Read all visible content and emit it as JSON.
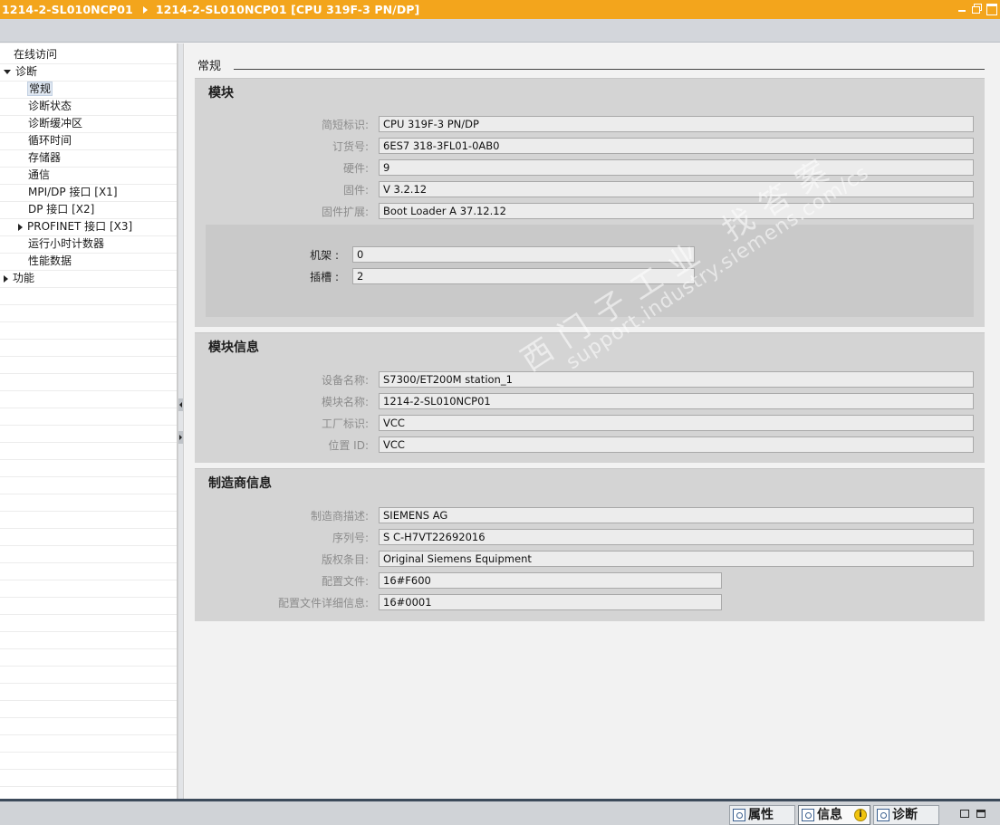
{
  "titlebar": {
    "crumb1": "1214-2-SL010NCP01",
    "crumb2": "1214-2-SL010NCP01 [CPU 319F-3 PN/DP]",
    "minimize_icon": "minimize-icon",
    "restore_icon": "restore-icon",
    "maximize_icon": "maximize-icon"
  },
  "tree": {
    "items": [
      {
        "label": "在线访问"
      },
      {
        "label": "诊断",
        "expanded": true
      },
      {
        "label": "常规",
        "selected": true
      },
      {
        "label": "诊断状态"
      },
      {
        "label": "诊断缓冲区"
      },
      {
        "label": "循环时间"
      },
      {
        "label": "存储器"
      },
      {
        "label": "通信"
      },
      {
        "label": "MPI/DP 接口 [X1]"
      },
      {
        "label": "DP 接口 [X2]"
      },
      {
        "label": "PROFINET 接口 [X3]",
        "expanded": false
      },
      {
        "label": "运行小时计数器"
      },
      {
        "label": "性能数据"
      },
      {
        "label": "功能",
        "expanded": false
      }
    ]
  },
  "content": {
    "section_title": "常规",
    "module": {
      "title": "模块",
      "short_id_label": "简短标识:",
      "short_id": "CPU 319F-3 PN/DP",
      "order_no_label": "订货号:",
      "order_no": "6ES7 318-3FL01-0AB0",
      "hardware_label": "硬件:",
      "hardware": "9",
      "firmware_label": "固件:",
      "firmware": "V 3.2.12",
      "fw_ext_label": "固件扩展:",
      "fw_ext": "Boot Loader A 37.12.12",
      "rack_label": "机架 :",
      "rack": "0",
      "slot_label": "插槽 :",
      "slot": "2"
    },
    "module_info": {
      "title": "模块信息",
      "device_name_label": "设备名称:",
      "device_name": "S7300/ET200M station_1",
      "module_name_label": "模块名称:",
      "module_name": "1214-2-SL010NCP01",
      "plant_id_label": "工厂标识:",
      "plant_id": "VCC",
      "location_id_label": "位置 ID:",
      "location_id": "VCC"
    },
    "manufacturer_info": {
      "title": "制造商信息",
      "mfr_desc_label": "制造商描述:",
      "mfr_desc": "SIEMENS AG",
      "serial_label": "序列号:",
      "serial": "S C-H7VT22692016",
      "copyright_label": "版权条目:",
      "copyright": "Original Siemens Equipment",
      "profile_label": "配置文件:",
      "profile": "16#F600",
      "profile_detail_label": "配置文件详细信息:",
      "profile_detail": "16#0001"
    }
  },
  "watermark": {
    "line1": "西门子工业 找答案",
    "line2": "support.industry.siemens.com/cs"
  },
  "statusbar": {
    "properties_label": "属性",
    "info_label": "信息",
    "diagnostics_label": "诊断",
    "info_badge": "i"
  }
}
